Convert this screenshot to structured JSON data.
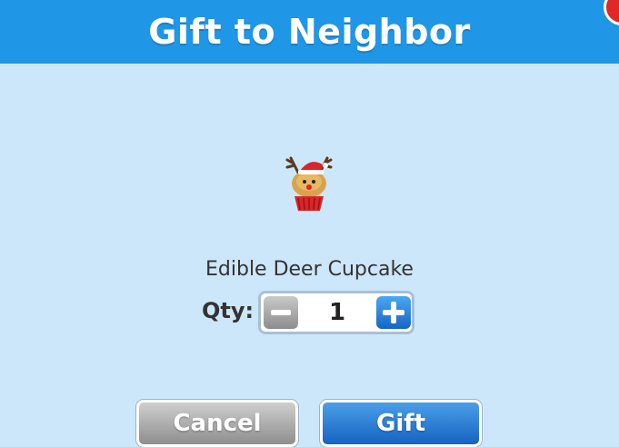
{
  "dialog": {
    "title": "Gift to Neighbor"
  },
  "item": {
    "name": "Edible Deer Cupcake",
    "icon": "deer-cupcake-icon"
  },
  "quantity": {
    "label": "Qty:",
    "value": "1"
  },
  "buttons": {
    "cancel_label": "Cancel",
    "gift_label": "Gift"
  },
  "colors": {
    "header": "#1f96e6",
    "background": "#cde7fa",
    "primary_button": "#1f7fd8",
    "secondary_button": "#aaaaaa",
    "close_button": "#e02828"
  }
}
